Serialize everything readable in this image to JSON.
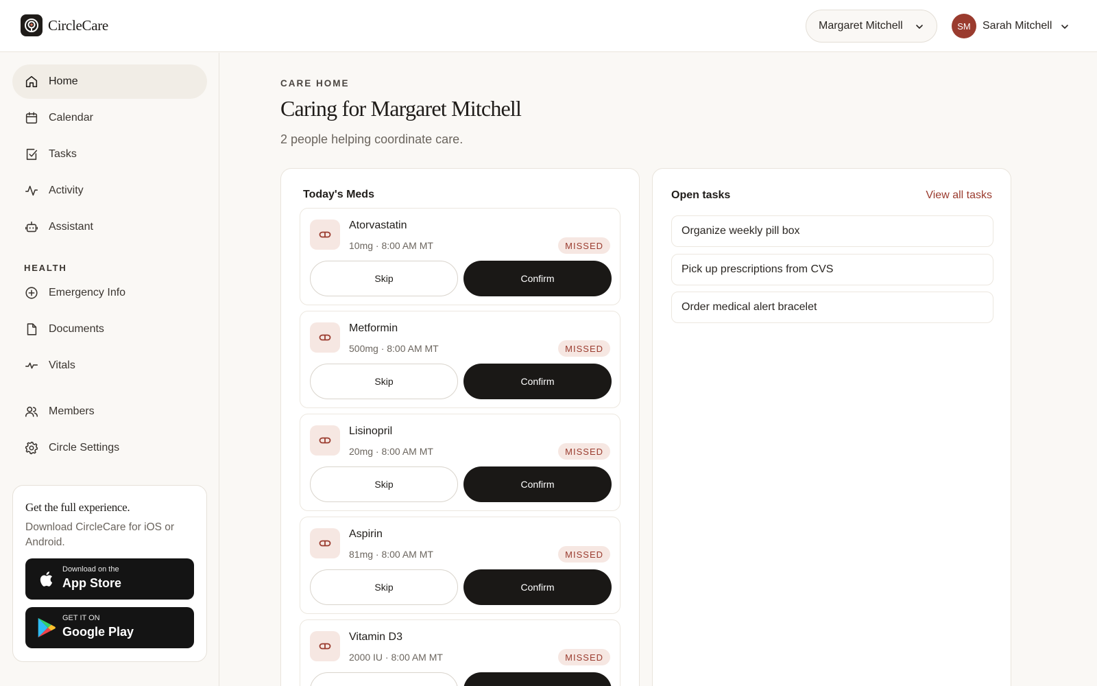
{
  "brand": {
    "name": "CircleCare",
    "icon": "circle-care-logo-icon"
  },
  "header": {
    "recipient_select": "Margaret Mitchell",
    "user": {
      "initials": "SM",
      "name": "Sarah Mitchell",
      "avatar_color": "#9a3b2e"
    }
  },
  "sidebar": {
    "items": [
      {
        "label": "Home",
        "icon": "home-icon",
        "active": true
      },
      {
        "label": "Calendar",
        "icon": "calendar-icon"
      },
      {
        "label": "Tasks",
        "icon": "task-check-icon"
      },
      {
        "label": "Activity",
        "icon": "activity-icon"
      },
      {
        "label": "Assistant",
        "icon": "robot-icon"
      }
    ],
    "health_heading": "HEALTH",
    "health_items": [
      {
        "label": "Emergency Info",
        "icon": "plus-circle-icon"
      },
      {
        "label": "Documents",
        "icon": "document-icon"
      },
      {
        "label": "Vitals",
        "icon": "vitals-icon"
      }
    ],
    "bottom_items": [
      {
        "label": "Members",
        "icon": "members-icon"
      },
      {
        "label": "Circle Settings",
        "icon": "gear-icon"
      }
    ],
    "promo": {
      "title": "Get the full experience.",
      "text": "Download CircleCare for iOS or Android.",
      "app_store": {
        "small": "Download on the",
        "big": "App Store"
      },
      "google_play": {
        "small": "GET IT ON",
        "big": "Google Play"
      }
    }
  },
  "main": {
    "eyebrow": "CARE HOME",
    "title": "Caring for Margaret Mitchell",
    "subtitle": "2 people helping coordinate care.",
    "meds": {
      "title": "Today's Meds",
      "skip_label": "Skip",
      "confirm_label": "Confirm",
      "items": [
        {
          "name": "Atorvastatin",
          "dose": "10mg · 8:00 AM MT",
          "status": "MISSED"
        },
        {
          "name": "Metformin",
          "dose": "500mg · 8:00 AM MT",
          "status": "MISSED"
        },
        {
          "name": "Lisinopril",
          "dose": "20mg · 8:00 AM MT",
          "status": "MISSED"
        },
        {
          "name": "Aspirin",
          "dose": "81mg · 8:00 AM MT",
          "status": "MISSED"
        },
        {
          "name": "Vitamin D3",
          "dose": "2000 IU · 8:00 AM MT",
          "status": "MISSED"
        }
      ]
    },
    "tasks": {
      "title": "Open tasks",
      "view_all": "View all tasks",
      "items": [
        "Organize weekly pill box",
        "Pick up prescriptions from CVS",
        "Order medical alert bracelet"
      ]
    }
  },
  "colors": {
    "accent": "#9a3b2e",
    "badge_bg": "#f6e7e2",
    "dark_button": "#1a1816",
    "background": "#faf8f5"
  }
}
